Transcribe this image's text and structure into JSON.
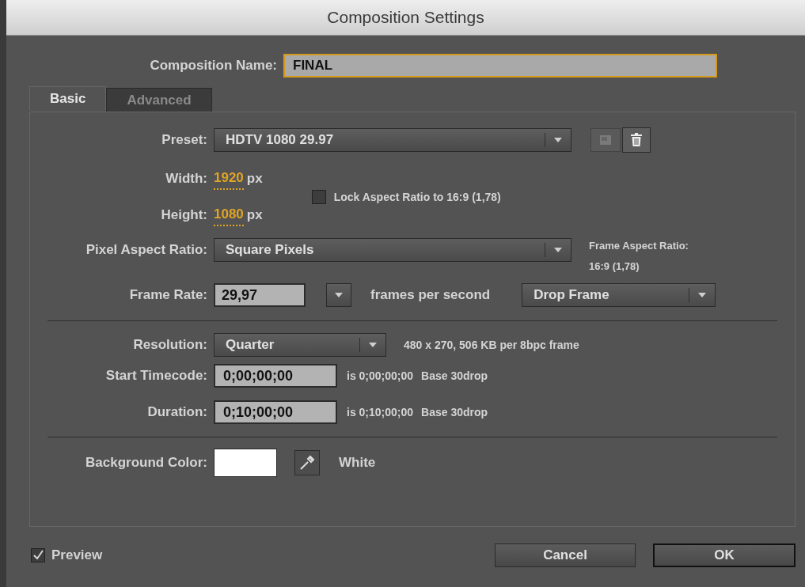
{
  "window": {
    "title": "Composition Settings"
  },
  "composition_name": {
    "label": "Composition Name:",
    "value": "FINAL"
  },
  "tabs": [
    {
      "label": "Basic",
      "selected": true
    },
    {
      "label": "Advanced",
      "selected": false
    }
  ],
  "preset": {
    "label": "Preset:",
    "value": "HDTV 1080 29.97"
  },
  "width": {
    "label": "Width:",
    "value": "1920",
    "unit": "px"
  },
  "height": {
    "label": "Height:",
    "value": "1080",
    "unit": "px"
  },
  "lock_aspect": {
    "label": "Lock Aspect Ratio to 16:9 (1,78)",
    "checked": false
  },
  "pixel_aspect_ratio": {
    "label": "Pixel Aspect Ratio:",
    "value": "Square Pixels"
  },
  "frame_aspect_ratio": {
    "label": "Frame Aspect Ratio:",
    "value": "16:9 (1,78)"
  },
  "frame_rate": {
    "label": "Frame Rate:",
    "value": "29,97",
    "unit": "frames per second",
    "mode": "Drop Frame"
  },
  "resolution": {
    "label": "Resolution:",
    "value": "Quarter",
    "info": "480 x 270, 506 KB per 8bpc frame"
  },
  "start_timecode": {
    "label": "Start Timecode:",
    "value": "0;00;00;00",
    "info": "is 0;00;00;00",
    "base": "Base 30drop"
  },
  "duration": {
    "label": "Duration:",
    "value": "0;10;00;00",
    "info": "is 0;10;00;00",
    "base": "Base 30drop"
  },
  "background_color": {
    "label": "Background Color:",
    "color": "#ffffff",
    "name": "White"
  },
  "preview": {
    "label": "Preview",
    "checked": true
  },
  "buttons": [
    {
      "label": "Cancel",
      "default": false
    },
    {
      "label": "OK",
      "default": true
    }
  ]
}
